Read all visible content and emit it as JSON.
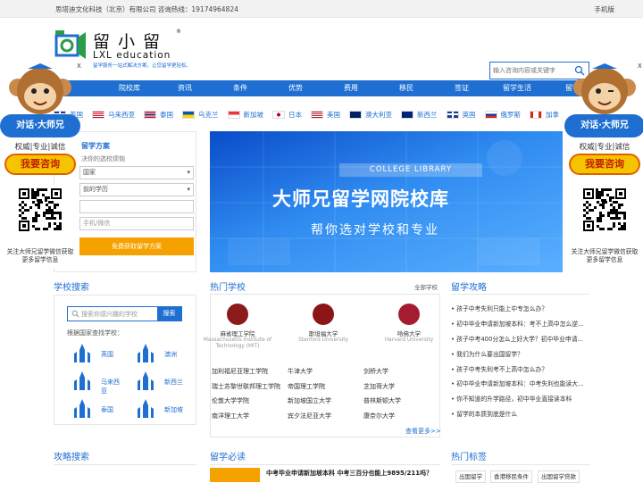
{
  "topbar": {
    "company": "思塔迪文化科技（北京）有限公司 咨询热线：19174964824",
    "mobile": "手机版"
  },
  "logo": {
    "cn": "留小留",
    "en": "LXL education",
    "slogan": "留学服务一站式解决方案，让您留学更轻松。",
    "reg": "®"
  },
  "search_top": {
    "placeholder": "输入咨询内容或关键字"
  },
  "nav": {
    "items": [
      "",
      "院校库",
      "资讯",
      "条件",
      "优势",
      "费用",
      "移民",
      "签证",
      "留学生活",
      "留学"
    ]
  },
  "countries": [
    {
      "name": "英国",
      "flag": "uk"
    },
    {
      "name": "马来西亚",
      "flag": "my"
    },
    {
      "name": "泰国",
      "flag": "th"
    },
    {
      "name": "乌克兰",
      "flag": "ua"
    },
    {
      "name": "新加坡",
      "flag": "sg"
    },
    {
      "name": "日本",
      "flag": "jp"
    },
    {
      "name": "美国",
      "flag": "us"
    },
    {
      "name": "澳大利亚",
      "flag": "au"
    },
    {
      "name": "新西兰",
      "flag": "nz"
    },
    {
      "name": "英国",
      "flag": "uk"
    },
    {
      "name": "俄罗斯",
      "flag": "ru"
    },
    {
      "name": "加拿",
      "flag": "ca"
    }
  ],
  "consult": {
    "title": "留学方案",
    "subtitle": "决你的选校烦恼",
    "select1": "国家",
    "select2": "前的学历",
    "input1": "",
    "input2": "手机/微信",
    "submit": "免费获取留学方案"
  },
  "banner": {
    "tag": "COLLEGE LIBRARY",
    "headline": "大师兄留学网院校库",
    "subline": "帮你选对学校和专业"
  },
  "school_search": {
    "title": "学校搜索",
    "placeholder": "搜索你感兴趣的学校",
    "button": "搜索",
    "by_country": "根据国家查找学校：",
    "lands": [
      "英国",
      "澳洲",
      "马来西亚",
      "新西兰",
      "泰国",
      "新加坡"
    ]
  },
  "hot_schools": {
    "title": "热门学校",
    "more": "全部学校",
    "featured": [
      {
        "name": "麻省理工学院",
        "en": "Massachusetts Institute of Technology (MIT)",
        "color": "#8b1a1a"
      },
      {
        "name": "斯坦福大学",
        "en": "Stanford University",
        "color": "#8c1515"
      },
      {
        "name": "哈佛大学",
        "en": "Harvard University",
        "color": "#a51c30"
      }
    ],
    "list": [
      [
        "加利福尼亚理工学院",
        "牛津大学",
        "剑桥大学"
      ],
      [
        "瑞士苏黎世联邦理工学院",
        "帝国理工学院",
        "芝加哥大学"
      ],
      [
        "伦敦大学学院",
        "新加坡国立大学",
        "普林斯顿大学"
      ],
      [
        "南洋理工大学",
        "宾夕法尼亚大学",
        "康奈尔大学"
      ]
    ],
    "see_more": "查看更多>>"
  },
  "guide": {
    "title": "留学攻略",
    "items": [
      "孩子中考失利只能上中专怎么办？",
      "初中毕业申请新加坡本科：考不上高中怎么逆...",
      "孩子中考400分怎么上好大学？初中毕业申请...",
      "我们为什么要出国留学？",
      "孩子中考失利考不上高中怎么办？",
      "初中毕业申请新加坡本科：中考失利也能读大...",
      "你不知道的升学路径，初中毕业直接读本科",
      "留学的本质到底是什么"
    ]
  },
  "bottom": {
    "strategy_title": "攻略搜索",
    "must_read_title": "留学必读",
    "news_headline": "中考毕业申请新加坡本科 中考三百分也能上9895/211吗？",
    "tags_title": "热门标签",
    "tags": [
      "出国留学",
      "香港移民条件",
      "出国留学贷款"
    ]
  },
  "float": {
    "badge": "对话·大师兄",
    "tagline": "权威|专业|诚信",
    "ask": "我要咨询",
    "qr_text": "关注大师兄留学微信获取更多留学信息",
    "close": "X"
  },
  "colors": {
    "brand": "#1e6fd1",
    "accent": "#f5a100"
  }
}
